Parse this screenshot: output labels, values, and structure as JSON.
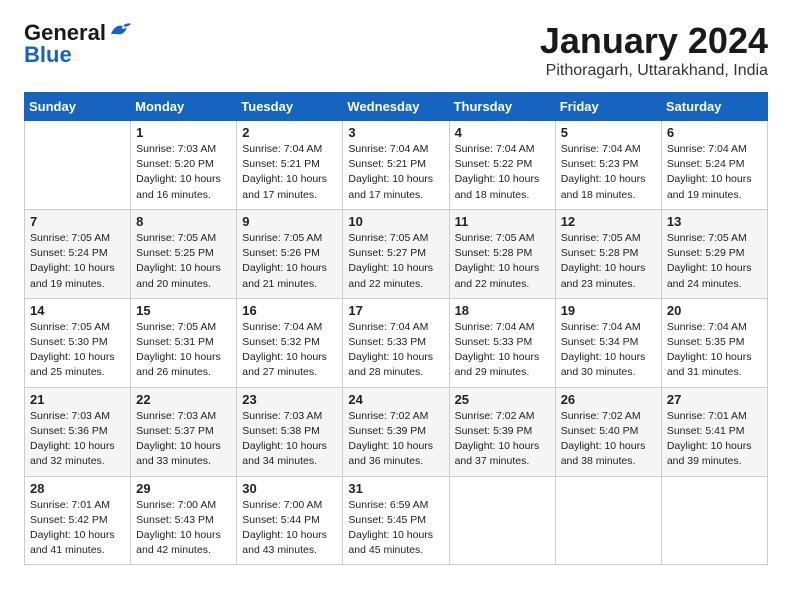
{
  "logo": {
    "general": "General",
    "blue": "Blue"
  },
  "header": {
    "month": "January 2024",
    "location": "Pithoragarh, Uttarakhand, India"
  },
  "days_of_week": [
    "Sunday",
    "Monday",
    "Tuesday",
    "Wednesday",
    "Thursday",
    "Friday",
    "Saturday"
  ],
  "weeks": [
    [
      {
        "day": "",
        "info": ""
      },
      {
        "day": "1",
        "info": "Sunrise: 7:03 AM\nSunset: 5:20 PM\nDaylight: 10 hours\nand 16 minutes."
      },
      {
        "day": "2",
        "info": "Sunrise: 7:04 AM\nSunset: 5:21 PM\nDaylight: 10 hours\nand 17 minutes."
      },
      {
        "day": "3",
        "info": "Sunrise: 7:04 AM\nSunset: 5:21 PM\nDaylight: 10 hours\nand 17 minutes."
      },
      {
        "day": "4",
        "info": "Sunrise: 7:04 AM\nSunset: 5:22 PM\nDaylight: 10 hours\nand 18 minutes."
      },
      {
        "day": "5",
        "info": "Sunrise: 7:04 AM\nSunset: 5:23 PM\nDaylight: 10 hours\nand 18 minutes."
      },
      {
        "day": "6",
        "info": "Sunrise: 7:04 AM\nSunset: 5:24 PM\nDaylight: 10 hours\nand 19 minutes."
      }
    ],
    [
      {
        "day": "7",
        "info": "Sunrise: 7:05 AM\nSunset: 5:24 PM\nDaylight: 10 hours\nand 19 minutes."
      },
      {
        "day": "8",
        "info": "Sunrise: 7:05 AM\nSunset: 5:25 PM\nDaylight: 10 hours\nand 20 minutes."
      },
      {
        "day": "9",
        "info": "Sunrise: 7:05 AM\nSunset: 5:26 PM\nDaylight: 10 hours\nand 21 minutes."
      },
      {
        "day": "10",
        "info": "Sunrise: 7:05 AM\nSunset: 5:27 PM\nDaylight: 10 hours\nand 22 minutes."
      },
      {
        "day": "11",
        "info": "Sunrise: 7:05 AM\nSunset: 5:28 PM\nDaylight: 10 hours\nand 22 minutes."
      },
      {
        "day": "12",
        "info": "Sunrise: 7:05 AM\nSunset: 5:28 PM\nDaylight: 10 hours\nand 23 minutes."
      },
      {
        "day": "13",
        "info": "Sunrise: 7:05 AM\nSunset: 5:29 PM\nDaylight: 10 hours\nand 24 minutes."
      }
    ],
    [
      {
        "day": "14",
        "info": "Sunrise: 7:05 AM\nSunset: 5:30 PM\nDaylight: 10 hours\nand 25 minutes."
      },
      {
        "day": "15",
        "info": "Sunrise: 7:05 AM\nSunset: 5:31 PM\nDaylight: 10 hours\nand 26 minutes."
      },
      {
        "day": "16",
        "info": "Sunrise: 7:04 AM\nSunset: 5:32 PM\nDaylight: 10 hours\nand 27 minutes."
      },
      {
        "day": "17",
        "info": "Sunrise: 7:04 AM\nSunset: 5:33 PM\nDaylight: 10 hours\nand 28 minutes."
      },
      {
        "day": "18",
        "info": "Sunrise: 7:04 AM\nSunset: 5:33 PM\nDaylight: 10 hours\nand 29 minutes."
      },
      {
        "day": "19",
        "info": "Sunrise: 7:04 AM\nSunset: 5:34 PM\nDaylight: 10 hours\nand 30 minutes."
      },
      {
        "day": "20",
        "info": "Sunrise: 7:04 AM\nSunset: 5:35 PM\nDaylight: 10 hours\nand 31 minutes."
      }
    ],
    [
      {
        "day": "21",
        "info": "Sunrise: 7:03 AM\nSunset: 5:36 PM\nDaylight: 10 hours\nand 32 minutes."
      },
      {
        "day": "22",
        "info": "Sunrise: 7:03 AM\nSunset: 5:37 PM\nDaylight: 10 hours\nand 33 minutes."
      },
      {
        "day": "23",
        "info": "Sunrise: 7:03 AM\nSunset: 5:38 PM\nDaylight: 10 hours\nand 34 minutes."
      },
      {
        "day": "24",
        "info": "Sunrise: 7:02 AM\nSunset: 5:39 PM\nDaylight: 10 hours\nand 36 minutes."
      },
      {
        "day": "25",
        "info": "Sunrise: 7:02 AM\nSunset: 5:39 PM\nDaylight: 10 hours\nand 37 minutes."
      },
      {
        "day": "26",
        "info": "Sunrise: 7:02 AM\nSunset: 5:40 PM\nDaylight: 10 hours\nand 38 minutes."
      },
      {
        "day": "27",
        "info": "Sunrise: 7:01 AM\nSunset: 5:41 PM\nDaylight: 10 hours\nand 39 minutes."
      }
    ],
    [
      {
        "day": "28",
        "info": "Sunrise: 7:01 AM\nSunset: 5:42 PM\nDaylight: 10 hours\nand 41 minutes."
      },
      {
        "day": "29",
        "info": "Sunrise: 7:00 AM\nSunset: 5:43 PM\nDaylight: 10 hours\nand 42 minutes."
      },
      {
        "day": "30",
        "info": "Sunrise: 7:00 AM\nSunset: 5:44 PM\nDaylight: 10 hours\nand 43 minutes."
      },
      {
        "day": "31",
        "info": "Sunrise: 6:59 AM\nSunset: 5:45 PM\nDaylight: 10 hours\nand 45 minutes."
      },
      {
        "day": "",
        "info": ""
      },
      {
        "day": "",
        "info": ""
      },
      {
        "day": "",
        "info": ""
      }
    ]
  ]
}
